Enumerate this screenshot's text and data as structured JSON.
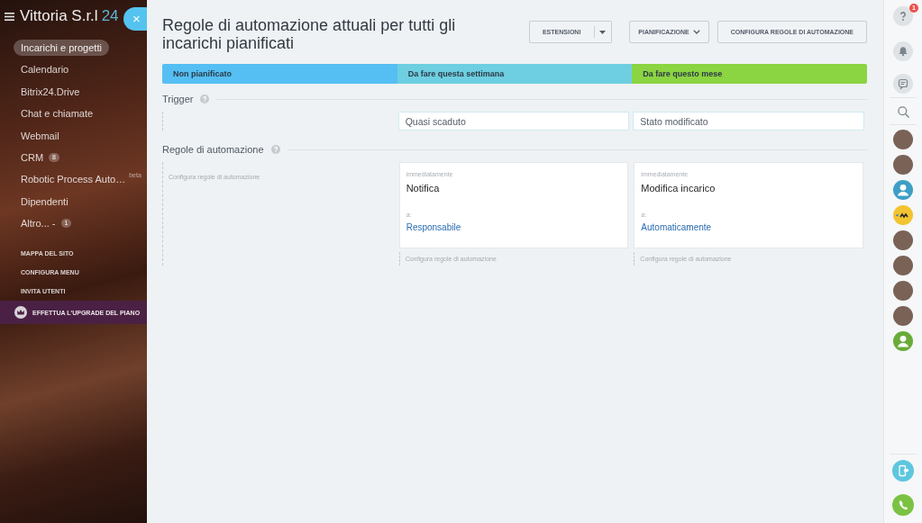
{
  "sidebar": {
    "logo": {
      "name": "Vittoria S.r.l",
      "number": "24"
    },
    "close_button": "×",
    "items": [
      {
        "label": "Incarichi e progetti",
        "selected": true
      },
      {
        "label": "Calendario",
        "selected": false
      },
      {
        "label": "Bitrix24.Drive",
        "selected": false
      },
      {
        "label": "Chat e chiamate",
        "selected": false
      },
      {
        "label": "Webmail",
        "selected": false
      },
      {
        "label": "CRM",
        "selected": false,
        "counter": "8"
      },
      {
        "label": "Robotic Process Auto…",
        "selected": false,
        "tag": "beta"
      },
      {
        "label": "Dipendenti",
        "selected": false
      },
      {
        "label": "Altro... -",
        "selected": false,
        "counter": "1"
      }
    ],
    "links": [
      "MAPPA DEL SITO",
      "CONFIGURA MENU",
      "INVITA UTENTI"
    ],
    "upgrade_button": "EFFETTUA L'UPGRADE DEL PIANO"
  },
  "header": {
    "title": "Regole di automazione attuali per tutti gli incarichi pianificati",
    "buttons": [
      {
        "label": "ESTENSIONI",
        "kind": "split"
      },
      {
        "label": "PIANIFICAZIONE",
        "kind": "dropdown"
      },
      {
        "label": "CONFIGURA REGOLE DI AUTOMAZIONE",
        "kind": "plain"
      }
    ]
  },
  "sections": {
    "triggers_title": "Trigger",
    "rules_title": "Regole di automazione"
  },
  "stages": [
    {
      "label": "Non pianificato",
      "color": "#55bff4",
      "add_rule_link": "Configura regole di automazione"
    },
    {
      "label": "Da fare questa settimana",
      "color": "#6dcfe1",
      "trigger": "Quasi scaduto",
      "rules": [
        {
          "delay": "immediatamente",
          "action": "Notifica",
          "target_label": "a:",
          "target": "Responsabile"
        }
      ],
      "add_rule_link": "Configura regole di automazione"
    },
    {
      "label": "Da fare questo mese",
      "color": "#8bd442",
      "trigger": "Stato modificato",
      "rules": [
        {
          "delay": "immediatamente",
          "action": "Modifica incarico",
          "target_label": "a:",
          "target": "Automaticamente"
        }
      ],
      "add_rule_link": "Configura regole di automazione"
    }
  ],
  "right_bar": {
    "help_badge": "1",
    "contacts": [
      {
        "kind": "photo"
      },
      {
        "kind": "photo"
      },
      {
        "kind": "silhouette",
        "color": "#3d9fc6"
      },
      {
        "kind": "logo"
      },
      {
        "kind": "photo"
      },
      {
        "kind": "photo"
      },
      {
        "kind": "photo"
      },
      {
        "kind": "photo"
      },
      {
        "kind": "silhouette",
        "color": "#6aab38"
      }
    ]
  }
}
